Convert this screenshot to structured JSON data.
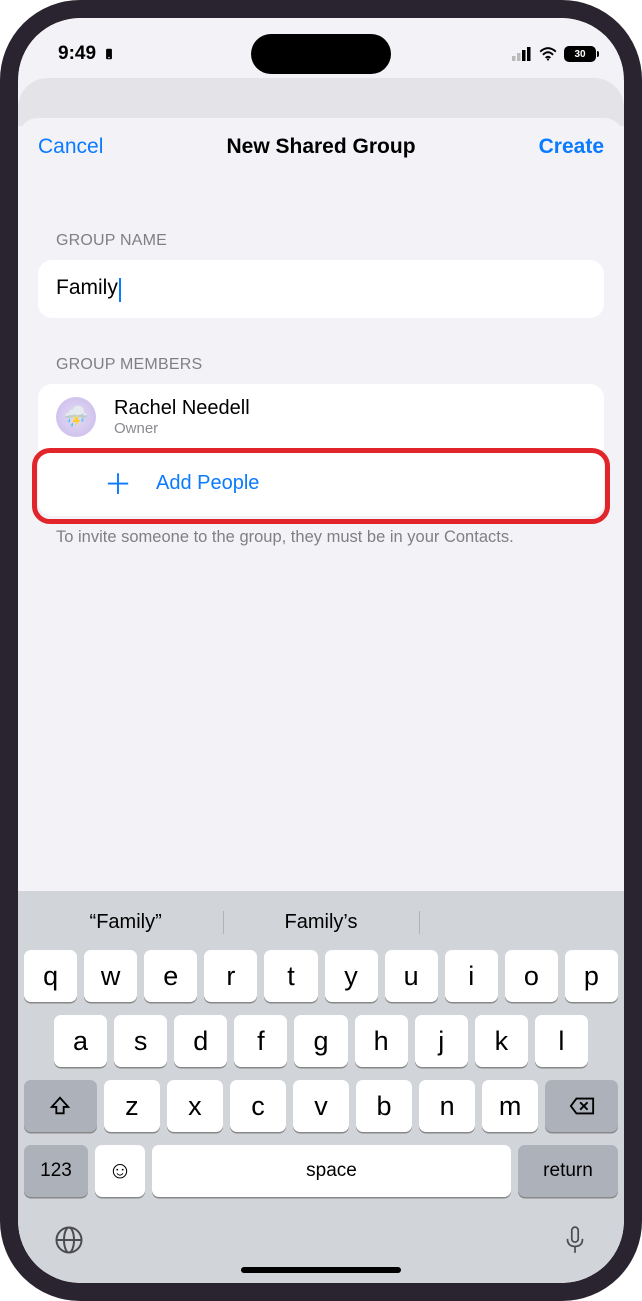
{
  "status": {
    "time": "9:49",
    "battery": "30"
  },
  "nav": {
    "cancel": "Cancel",
    "title": "New Shared Group",
    "create": "Create"
  },
  "section1": {
    "header": "GROUP NAME",
    "value": "Family"
  },
  "section2": {
    "header": "GROUP MEMBERS",
    "owner_name": "Rachel Needell",
    "owner_role": "Owner",
    "add_label": "Add People",
    "footer": "To invite someone to the group, they must be in your Contacts."
  },
  "suggestions": [
    "“Family”",
    "Family’s",
    ""
  ],
  "keys": {
    "row1": [
      "q",
      "w",
      "e",
      "r",
      "t",
      "y",
      "u",
      "i",
      "o",
      "p"
    ],
    "row2": [
      "a",
      "s",
      "d",
      "f",
      "g",
      "h",
      "j",
      "k",
      "l"
    ],
    "row3": [
      "z",
      "x",
      "c",
      "v",
      "b",
      "n",
      "m"
    ],
    "num": "123",
    "space": "space",
    "return": "return"
  }
}
